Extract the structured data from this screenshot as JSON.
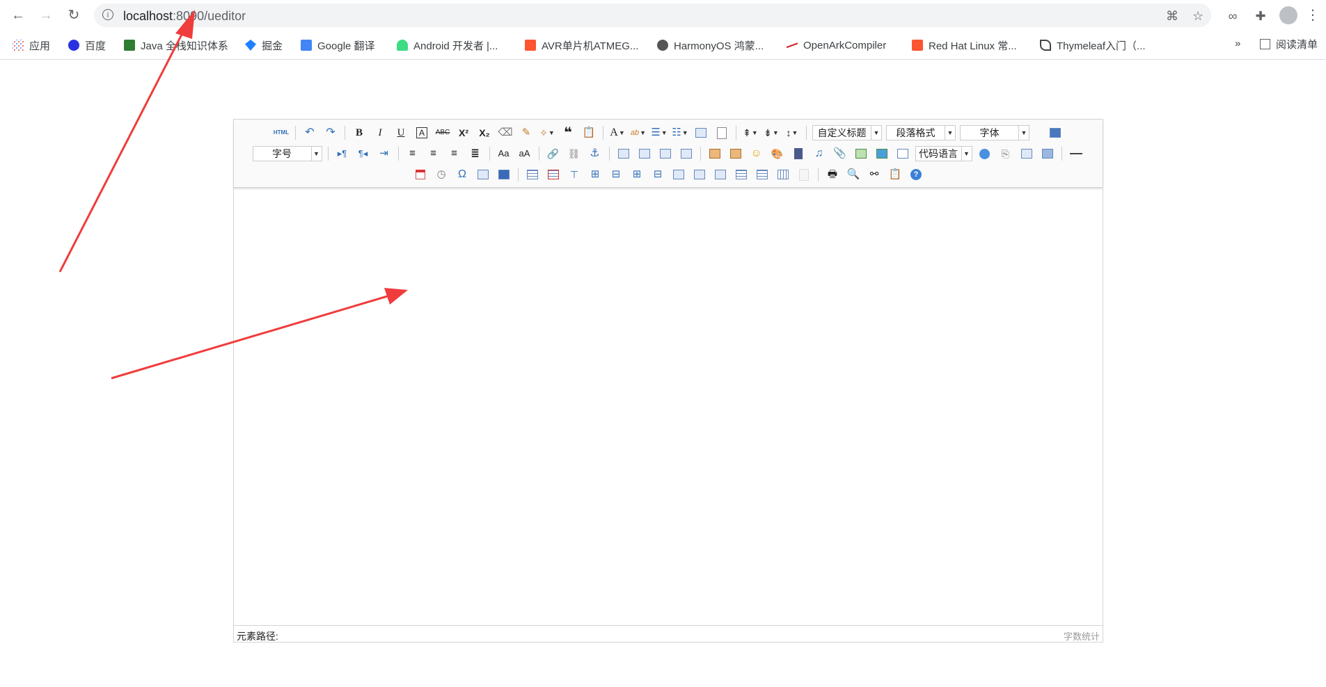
{
  "browser": {
    "url_host": "localhost",
    "url_port_path": ":8090/ueditor",
    "nav": {
      "back": "←",
      "forward": "→",
      "reload": "↻"
    }
  },
  "bookmarks": {
    "items": [
      {
        "label": "应用",
        "color": "#ea4335"
      },
      {
        "label": "百度",
        "color": "#2932e1"
      },
      {
        "label": "Java 全栈知识体系",
        "color": "#2e7d32"
      },
      {
        "label": "掘金",
        "color": "#1e80ff"
      },
      {
        "label": "Google 翻译",
        "color": "#4285f4"
      },
      {
        "label": "Android 开发者 |...",
        "color": "#3ddc84"
      },
      {
        "label": "AVR单片机ATMEG...",
        "color": "#fc5531"
      },
      {
        "label": "HarmonyOS 鸿蒙...",
        "color": "#555555"
      },
      {
        "label": "OpenArkCompiler",
        "color": "#d32f2f"
      },
      {
        "label": "Red Hat Linux 常...",
        "color": "#fc5531"
      },
      {
        "label": "Thymeleaf入门（...",
        "color": "#444444"
      }
    ],
    "more": "»",
    "reading_list": "阅读清单"
  },
  "toolbar": {
    "custom_heading": "自定义标题",
    "paragraph_format": "段落格式",
    "font_family": "字体",
    "font_size": "字号",
    "code_language": "代码语言",
    "html_label": "HTML"
  },
  "statusbar": {
    "element_path": "元素路径:",
    "word_count": "字数统计"
  },
  "annotations": {
    "arrow_color": "#f03c3c"
  }
}
